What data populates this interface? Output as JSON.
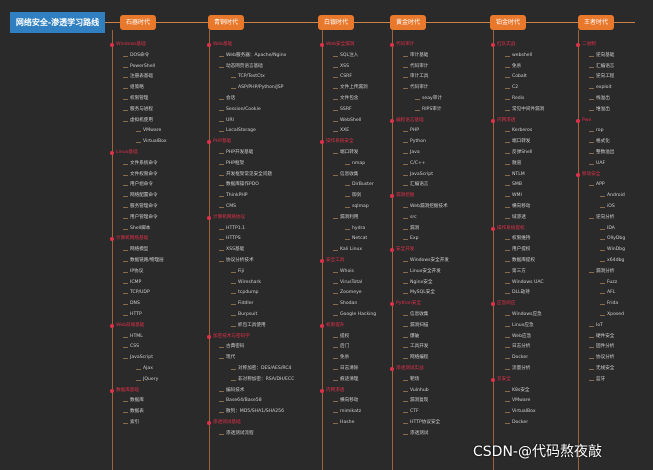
{
  "title": "网络安全-渗透学习路线",
  "watermark": "CSDN-@代码熬夜敲",
  "colors": {
    "background": "#2a2a2a",
    "title": "#2f7fc1",
    "era": "#e8782c",
    "heading": "#e0314a"
  },
  "eras": [
    {
      "label": "石器时代",
      "items": [
        [
          0,
          "Windows基础"
        ],
        [
          1,
          "DOS命令"
        ],
        [
          1,
          "PowerShell"
        ],
        [
          1,
          "注册表基础"
        ],
        [
          1,
          "组策略"
        ],
        [
          1,
          "权限管理"
        ],
        [
          1,
          "服务与进程"
        ],
        [
          1,
          "虚拟机使用"
        ],
        [
          2,
          "VMware"
        ],
        [
          2,
          "VirtualBox"
        ],
        [
          0,
          "Linux基础"
        ],
        [
          1,
          "文件系统命令"
        ],
        [
          1,
          "文件权限命令"
        ],
        [
          1,
          "用户组命令"
        ],
        [
          1,
          "网络配置命令"
        ],
        [
          1,
          "服务管理命令"
        ],
        [
          1,
          "用户管理命令"
        ],
        [
          1,
          "Shell脚本"
        ],
        [
          0,
          "计算机网络基础"
        ],
        [
          1,
          "网络模型"
        ],
        [
          1,
          "数据链路/物理层"
        ],
        [
          1,
          "IP协议"
        ],
        [
          1,
          "ICMP"
        ],
        [
          1,
          "TCP/UDP"
        ],
        [
          1,
          "DNS"
        ],
        [
          1,
          "HTTP"
        ],
        [
          0,
          "Web前端基础"
        ],
        [
          1,
          "HTML"
        ],
        [
          1,
          "CSS"
        ],
        [
          1,
          "JavaScript"
        ],
        [
          2,
          "Ajax"
        ],
        [
          2,
          "JQuery"
        ],
        [
          0,
          "数据库基础"
        ],
        [
          1,
          "数据库"
        ],
        [
          1,
          "数据表"
        ],
        [
          1,
          "索引"
        ]
      ]
    },
    {
      "label": "青铜时代",
      "items": [
        [
          0,
          "Web基础"
        ],
        [
          1,
          "Web服务器：Apache/Nginx"
        ],
        [
          1,
          "动态网页语言基础"
        ],
        [
          2,
          "TCP/TestCtx"
        ],
        [
          2,
          "ASP/PHP/Python/JSP"
        ],
        [
          1,
          "会话"
        ],
        [
          1,
          "Session/Cookie"
        ],
        [
          1,
          "URI"
        ],
        [
          1,
          "LocalStorage"
        ],
        [
          0,
          "PHP基础"
        ],
        [
          1,
          "PHP开发基础"
        ],
        [
          1,
          "PHP框架"
        ],
        [
          1,
          "开发框架常见安全问题"
        ],
        [
          1,
          "数据库操作PDO"
        ],
        [
          1,
          "ThinkPHP"
        ],
        [
          1,
          "CMS"
        ],
        [
          0,
          "计算机网络协议"
        ],
        [
          1,
          "HTTP1.1"
        ],
        [
          1,
          "HTTPS"
        ],
        [
          1,
          "XSS基础"
        ],
        [
          1,
          "协议分析技术"
        ],
        [
          2,
          "Fiji"
        ],
        [
          2,
          "Wireshark"
        ],
        [
          2,
          "tcpdump"
        ],
        [
          2,
          "Fiddler"
        ],
        [
          2,
          "Burpsuit"
        ],
        [
          2,
          "抓包工具使用"
        ],
        [
          0,
          "加密技术与密码学"
        ],
        [
          1,
          "古典密码"
        ],
        [
          1,
          "现代"
        ],
        [
          2,
          "对称加密：DES/AES/RC4"
        ],
        [
          2,
          "非对称加密：RSA/DH/ECC"
        ],
        [
          1,
          "编码技术"
        ],
        [
          1,
          "Base64/Base58"
        ],
        [
          1,
          "散列：MD5/SHA1/SHA256"
        ],
        [
          0,
          "渗透测试基础"
        ],
        [
          1,
          "渗透测试流程"
        ]
      ]
    },
    {
      "label": "白银时代",
      "items": [
        [
          0,
          "Web安全漏洞"
        ],
        [
          1,
          "SQL注入"
        ],
        [
          1,
          "XSS"
        ],
        [
          1,
          "CSRF"
        ],
        [
          1,
          "文件上传漏洞"
        ],
        [
          1,
          "文件包含"
        ],
        [
          1,
          "SSRF"
        ],
        [
          1,
          "WebShell"
        ],
        [
          1,
          "XXE"
        ],
        [
          0,
          "操作系统安全"
        ],
        [
          1,
          "端口转发"
        ],
        [
          2,
          "nmap"
        ],
        [
          1,
          "信息收集"
        ],
        [
          2,
          "DirBuster"
        ],
        [
          2,
          "御剑"
        ],
        [
          2,
          "sqlmap"
        ],
        [
          1,
          "漏洞利用"
        ],
        [
          2,
          "hydra"
        ],
        [
          2,
          "Netcat"
        ],
        [
          1,
          "Kali Linux"
        ],
        [
          0,
          "安全工具"
        ],
        [
          1,
          "Whois"
        ],
        [
          1,
          "VirusTotal"
        ],
        [
          1,
          "Zoomeye"
        ],
        [
          1,
          "Shodan"
        ],
        [
          1,
          "Google Hacking"
        ],
        [
          0,
          "权限提升"
        ],
        [
          1,
          "提权"
        ],
        [
          1,
          "后门"
        ],
        [
          1,
          "免杀"
        ],
        [
          1,
          "日志清除"
        ],
        [
          1,
          "痕迹清理"
        ],
        [
          0,
          "内网渗透"
        ],
        [
          1,
          "横向移动"
        ],
        [
          1,
          "mimikatz"
        ],
        [
          1,
          "Hashe"
        ]
      ]
    },
    {
      "label": "黄金时代",
      "items": [
        [
          0,
          "代码审计"
        ],
        [
          1,
          "审计基础"
        ],
        [
          1,
          "代码审计"
        ],
        [
          1,
          "审计工具"
        ],
        [
          1,
          "代码审计"
        ],
        [
          2,
          "seay审计"
        ],
        [
          2,
          "RIPS审计"
        ],
        [
          0,
          "编程语言基础"
        ],
        [
          1,
          "PHP"
        ],
        [
          1,
          "Python"
        ],
        [
          1,
          "Java"
        ],
        [
          1,
          "C/C++"
        ],
        [
          1,
          "JavaScript"
        ],
        [
          1,
          "汇编语言"
        ],
        [
          0,
          "漏洞挖掘"
        ],
        [
          1,
          "Web漏洞挖掘技术"
        ],
        [
          1,
          "src"
        ],
        [
          1,
          "漏洞"
        ],
        [
          1,
          "Exp"
        ],
        [
          0,
          "安全开发"
        ],
        [
          1,
          "Windows安全开发"
        ],
        [
          1,
          "Linux安全开发"
        ],
        [
          1,
          "Nginx安全"
        ],
        [
          1,
          "MySQL安全"
        ],
        [
          0,
          "Python安全"
        ],
        [
          1,
          "信息收集"
        ],
        [
          1,
          "漏洞扫描"
        ],
        [
          1,
          "爆破"
        ],
        [
          1,
          "工具开发"
        ],
        [
          1,
          "网络编程"
        ],
        [
          0,
          "渗透测试实战"
        ],
        [
          1,
          "靶场"
        ],
        [
          1,
          "Vulnhub"
        ],
        [
          1,
          "漏洞复现"
        ],
        [
          1,
          "CTF"
        ],
        [
          1,
          "HTTP协议安全"
        ],
        [
          1,
          "渗透测试"
        ]
      ]
    },
    {
      "label": "铂金时代",
      "items": [
        [
          0,
          "红队实战"
        ],
        [
          1,
          "webshell"
        ],
        [
          1,
          "免杀"
        ],
        [
          1,
          "Cobalt"
        ],
        [
          1,
          "C2"
        ],
        [
          1,
          "Redis"
        ],
        [
          1,
          "常见中间件漏洞"
        ],
        [
          0,
          "内网渗透"
        ],
        [
          1,
          "Kerberos"
        ],
        [
          1,
          "端口转发"
        ],
        [
          1,
          "反弹Shell"
        ],
        [
          1,
          "隧道"
        ],
        [
          1,
          "NTLM"
        ],
        [
          1,
          "SMB"
        ],
        [
          1,
          "WMI"
        ],
        [
          1,
          "横向移动"
        ],
        [
          1,
          "域渗透"
        ],
        [
          0,
          "操作系统提权"
        ],
        [
          1,
          "权限维持"
        ],
        [
          1,
          "用户提权"
        ],
        [
          1,
          "数据库提权"
        ],
        [
          1,
          "第三方"
        ],
        [
          1,
          "Windows UAC"
        ],
        [
          1,
          "DLL劫持"
        ],
        [
          0,
          "应急响应"
        ],
        [
          1,
          "Windows应急"
        ],
        [
          1,
          "Linux应急"
        ],
        [
          1,
          "Web应急"
        ],
        [
          1,
          "日志分析"
        ],
        [
          1,
          "Docker"
        ],
        [
          1,
          "流量分析"
        ],
        [
          0,
          "云安全"
        ],
        [
          1,
          "K8s安全"
        ],
        [
          1,
          "VMware"
        ],
        [
          1,
          "VirtualBox"
        ],
        [
          1,
          "Docker"
        ]
      ]
    },
    {
      "label": "王者时代",
      "items": [
        [
          0,
          "二进制"
        ],
        [
          1,
          "逆向基础"
        ],
        [
          1,
          "汇编语言"
        ],
        [
          1,
          "逆向工程"
        ],
        [
          1,
          "exploit"
        ],
        [
          1,
          "栈溢出"
        ],
        [
          1,
          "堆溢出"
        ],
        [
          0,
          "Pwn"
        ],
        [
          1,
          "rop"
        ],
        [
          1,
          "格式化"
        ],
        [
          1,
          "整数溢出"
        ],
        [
          1,
          "UAF"
        ],
        [
          0,
          "移动安全"
        ],
        [
          1,
          "APP"
        ],
        [
          2,
          "Android"
        ],
        [
          2,
          "iOS"
        ],
        [
          1,
          "逆向分析"
        ],
        [
          2,
          "IDA"
        ],
        [
          2,
          "OllyDbg"
        ],
        [
          2,
          "WinDbg"
        ],
        [
          2,
          "x64dbg"
        ],
        [
          1,
          "漏洞分析"
        ],
        [
          2,
          "Fuzz"
        ],
        [
          2,
          "AFL"
        ],
        [
          2,
          "Frida"
        ],
        [
          2,
          "Xposed"
        ],
        [
          1,
          "IoT"
        ],
        [
          1,
          "硬件安全"
        ],
        [
          1,
          "固件分析"
        ],
        [
          1,
          "协议分析"
        ],
        [
          1,
          "无线安全"
        ],
        [
          1,
          "蓝牙"
        ]
      ]
    }
  ]
}
